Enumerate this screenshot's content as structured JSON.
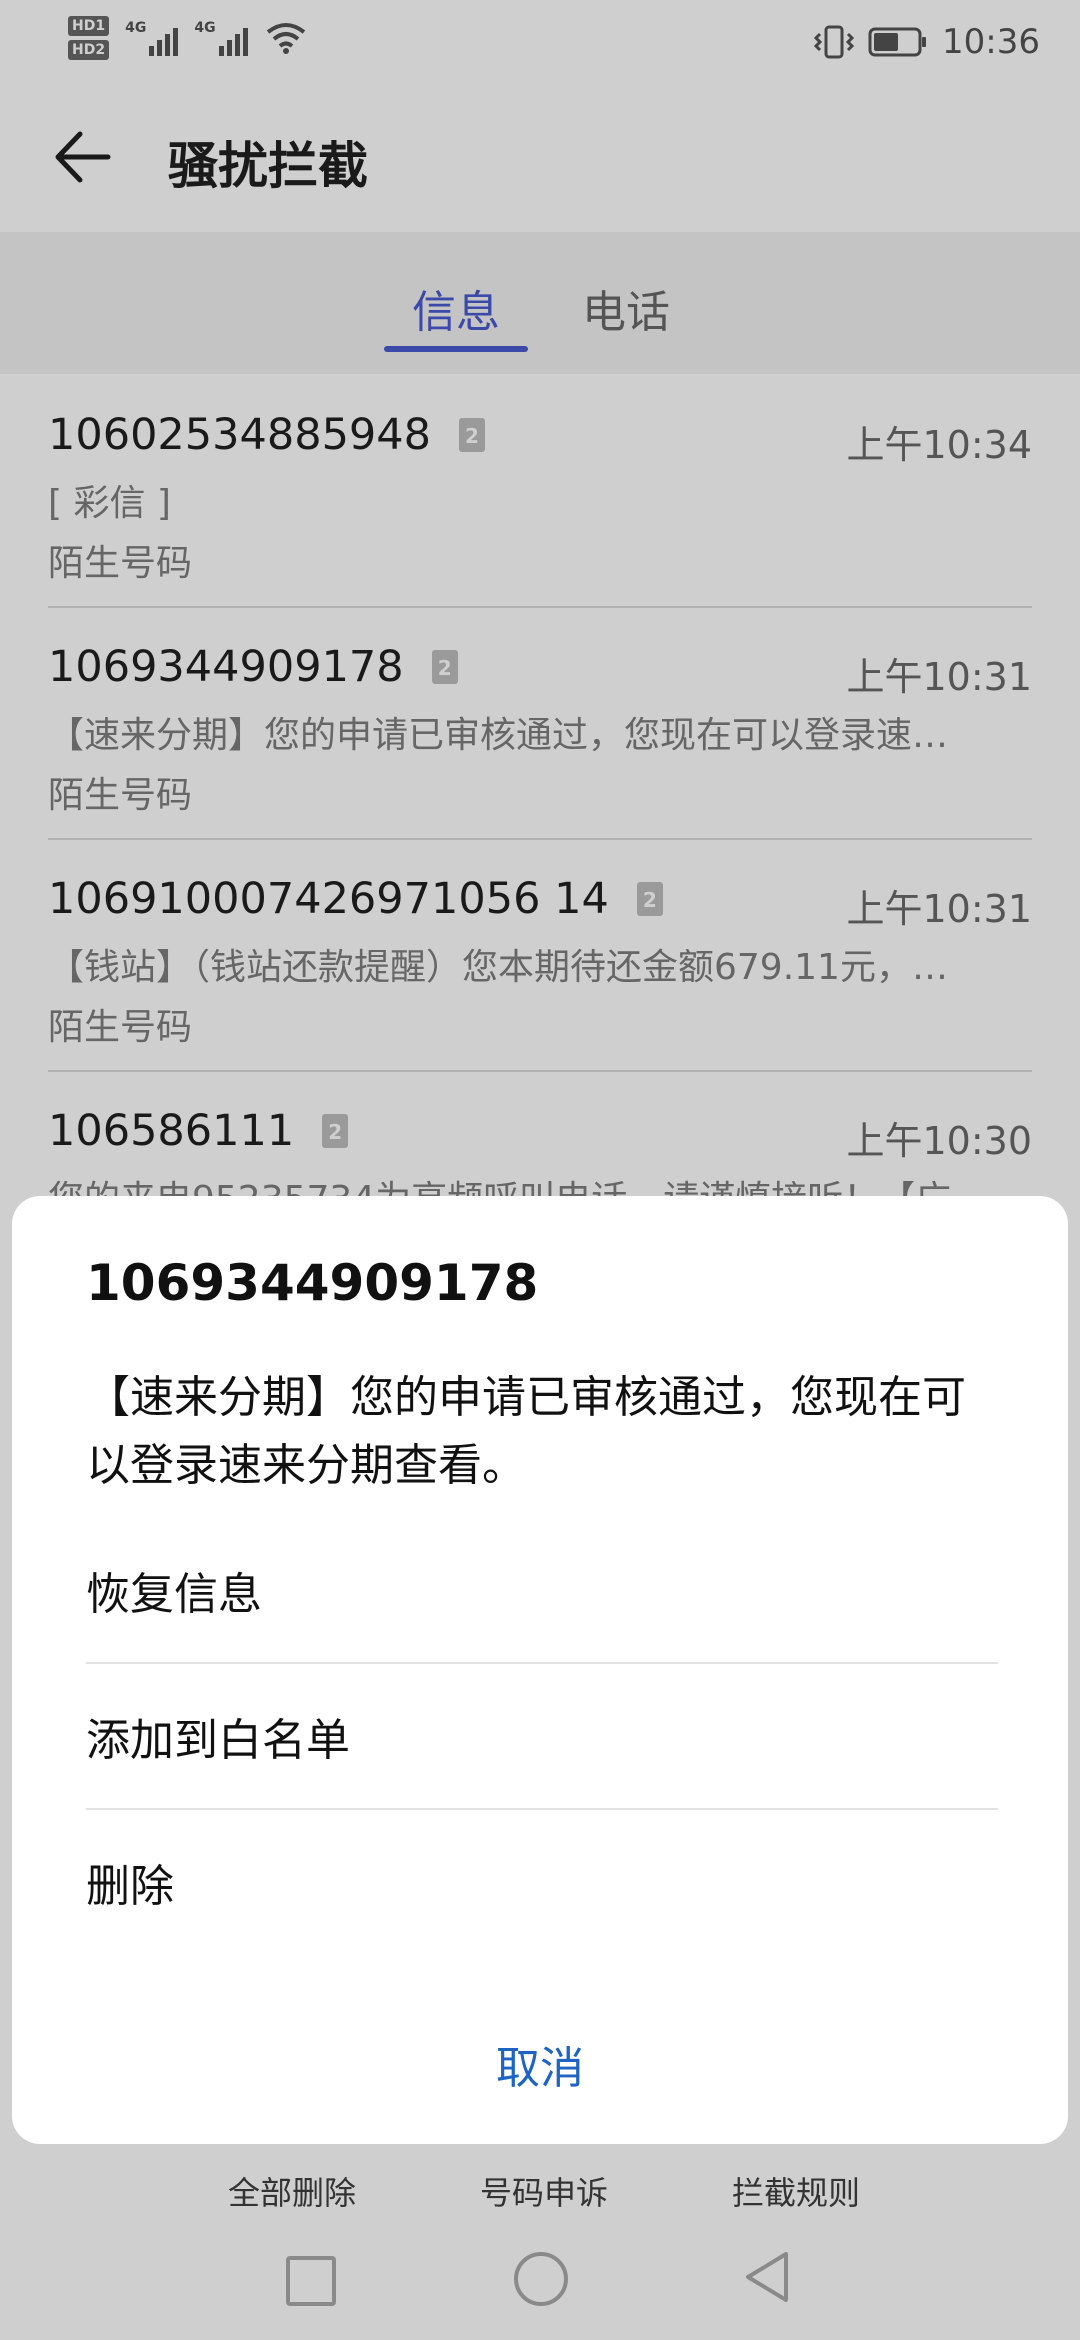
{
  "status": {
    "hd1": "HD1",
    "hd2": "HD2",
    "net1": "4G",
    "net2": "4G",
    "time": "10:36"
  },
  "header": {
    "title": "骚扰拦截"
  },
  "tabs": [
    {
      "label": "信息"
    },
    {
      "label": "电话"
    }
  ],
  "messages": [
    {
      "number": "10602534885948",
      "sim": "2",
      "time": "上午10:34",
      "preview": "[ 彩信 ]",
      "tag": "陌生号码"
    },
    {
      "number": "1069344909178",
      "sim": "2",
      "time": "上午10:31",
      "preview": "【速来分期】您的申请已审核通过，您现在可以登录速…",
      "tag": "陌生号码"
    },
    {
      "number": "106910007426971056 14",
      "sim": "2",
      "time": "上午10:31",
      "preview": "【钱站】（钱站还款提醒）您本期待还金额679.11元，…",
      "tag": "陌生号码"
    },
    {
      "number": "106586111",
      "sim": "2",
      "time": "上午10:30",
      "preview": "您的来电95235734为高频呼叫电话，请谨慎接听！【广",
      "tag": ""
    }
  ],
  "sheet": {
    "title": "1069344909178",
    "body": "【速来分期】您的申请已审核通过，您现在可以登录速来分期查看。",
    "options": [
      {
        "label": "恢复信息"
      },
      {
        "label": "添加到白名单"
      },
      {
        "label": "删除"
      }
    ],
    "cancel": "取消"
  },
  "bottom_actions": [
    {
      "label": "全部删除"
    },
    {
      "label": "号码申诉"
    },
    {
      "label": "拦截规则"
    }
  ],
  "colors": {
    "accent": "#3b4aa8",
    "cancel": "#1f64c4"
  }
}
